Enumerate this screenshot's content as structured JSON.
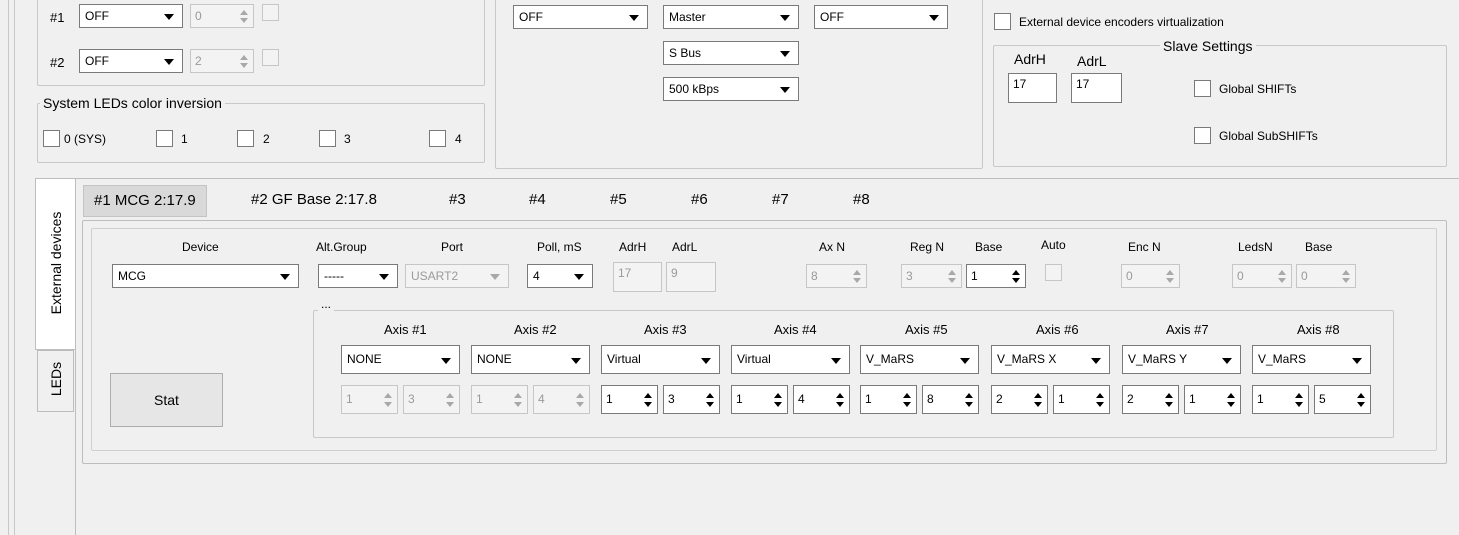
{
  "rows": [
    {
      "label": "#1",
      "mode": "OFF",
      "spin": "0"
    },
    {
      "label": "#2",
      "mode": "OFF",
      "spin": "2"
    }
  ],
  "sys_leds": {
    "title": "System LEDs color inversion",
    "items": [
      "0 (SYS)",
      "1",
      "2",
      "3",
      "4"
    ]
  },
  "bus": {
    "combo_a": "OFF",
    "combo_master": "Master",
    "combo_c": "OFF",
    "combo_bus": "S Bus",
    "combo_speed": "500 kBps"
  },
  "ext_virt_label": "External device encoders virtualization",
  "slave": {
    "title": "Slave Settings",
    "adrh_label": "AdrH",
    "adrl_label": "AdrL",
    "adrh": "17",
    "adrl": "17",
    "global_shifts": "Global SHIFTs",
    "global_subshifts": "Global SubSHIFTs"
  },
  "side_tabs": [
    "External devices",
    "LEDs"
  ],
  "device_tabs": [
    "#1 MCG 2:17.9",
    "#2 GF Base 2:17.8",
    "#3",
    "#4",
    "#5",
    "#6",
    "#7",
    "#8"
  ],
  "device": {
    "headers": {
      "device": "Device",
      "alt_group": "Alt.Group",
      "port": "Port",
      "poll": "Poll, mS",
      "adrh": "AdrH",
      "adrl": "AdrL",
      "axn": "Ax N",
      "regn": "Reg N",
      "base": "Base",
      "auto": "Auto",
      "encn": "Enc N",
      "ledsn": "LedsN",
      "base2": "Base"
    },
    "values": {
      "device": "MCG",
      "alt_group": "-----",
      "port": "USART2",
      "poll": "4",
      "adrh": "17",
      "adrl": "9",
      "axn": "8",
      "regn": "3",
      "base": "1",
      "encn": "0",
      "ledsn": "0",
      "base2": "0"
    },
    "axes_title": "...",
    "stat_button": "Stat"
  },
  "axes": [
    {
      "label": "Axis #1",
      "type": "NONE",
      "a": "1",
      "b": "3",
      "enabled": false
    },
    {
      "label": "Axis #2",
      "type": "NONE",
      "a": "1",
      "b": "4",
      "enabled": false
    },
    {
      "label": "Axis #3",
      "type": "Virtual",
      "a": "1",
      "b": "3",
      "enabled": true
    },
    {
      "label": "Axis #4",
      "type": "Virtual",
      "a": "1",
      "b": "4",
      "enabled": true
    },
    {
      "label": "Axis #5",
      "type": "V_MaRS",
      "a": "1",
      "b": "8",
      "enabled": true
    },
    {
      "label": "Axis #6",
      "type": "V_MaRS X",
      "a": "2",
      "b": "1",
      "enabled": true
    },
    {
      "label": "Axis #7",
      "type": "V_MaRS Y",
      "a": "2",
      "b": "1",
      "enabled": true
    },
    {
      "label": "Axis #8",
      "type": "V_MaRS",
      "a": "1",
      "b": "5",
      "enabled": true
    }
  ]
}
